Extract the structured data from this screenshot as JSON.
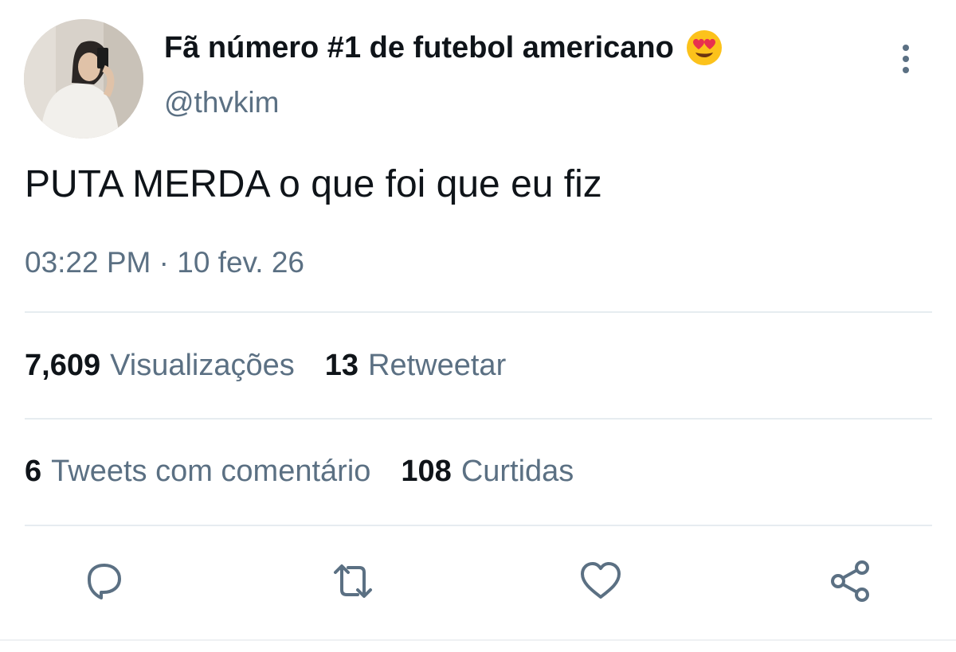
{
  "tweet": {
    "display_name": "Fã número #1 de futebol americano",
    "emoji_icon": "heart-eyes-emoji",
    "handle": "@thvkim",
    "text": "PUTA MERDA o que foi que eu fiz",
    "timestamp": "03:22 PM · 10 fev. 26"
  },
  "stats": {
    "views_count": "7,609",
    "views_label": "Visualizações",
    "retweets_count": "13",
    "retweets_label": "Retweetar",
    "quotes_count": "6",
    "quotes_label": "Tweets com comentário",
    "likes_count": "108",
    "likes_label": "Curtidas"
  },
  "actions": [
    "reply-icon",
    "retweet-icon",
    "like-icon",
    "share-icon"
  ],
  "colors": {
    "primary_text": "#0f1419",
    "secondary_text": "#5b7083",
    "divider": "#e6ecf0",
    "icon": "#5b7083"
  }
}
